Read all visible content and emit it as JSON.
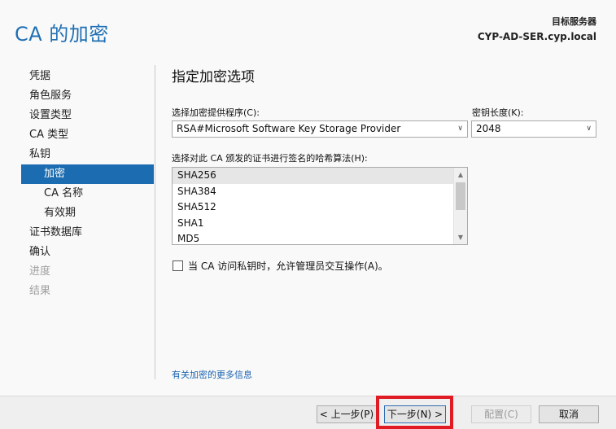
{
  "header": {
    "title": "CA 的加密",
    "server_label": "目标服务器",
    "server_name": "CYP-AD-SER.cyp.local"
  },
  "nav": {
    "items": [
      {
        "label": "凭据",
        "state": "normal"
      },
      {
        "label": "角色服务",
        "state": "normal"
      },
      {
        "label": "设置类型",
        "state": "normal"
      },
      {
        "label": "CA 类型",
        "state": "normal"
      },
      {
        "label": "私钥",
        "state": "normal"
      },
      {
        "label": "加密",
        "state": "active"
      },
      {
        "label": "CA 名称",
        "state": "sub"
      },
      {
        "label": "有效期",
        "state": "sub"
      },
      {
        "label": "证书数据库",
        "state": "normal"
      },
      {
        "label": "确认",
        "state": "normal"
      },
      {
        "label": "进度",
        "state": "disabled"
      },
      {
        "label": "结果",
        "state": "disabled"
      }
    ]
  },
  "main": {
    "section_title": "指定加密选项",
    "provider": {
      "label": "选择加密提供程序(C):",
      "value": "RSA#Microsoft Software Key Storage Provider"
    },
    "key_length": {
      "label": "密钥长度(K):",
      "value": "2048"
    },
    "hash": {
      "label": "选择对此 CA 颁发的证书进行签名的哈希算法(H):",
      "options": [
        "SHA256",
        "SHA384",
        "SHA512",
        "SHA1",
        "MD5"
      ],
      "selected": "SHA256"
    },
    "allow_interaction": {
      "label": "当 CA 访问私钥时，允许管理员交互操作(A)。",
      "checked": false
    },
    "more_info_link": "有关加密的更多信息"
  },
  "footer": {
    "prev": "< 上一步(P)",
    "next": "下一步(N) >",
    "configure": "配置(C)",
    "cancel": "取消"
  },
  "colors": {
    "accent": "#1b6cb0",
    "title": "#1f6fb4",
    "highlight": "#e01b24"
  }
}
